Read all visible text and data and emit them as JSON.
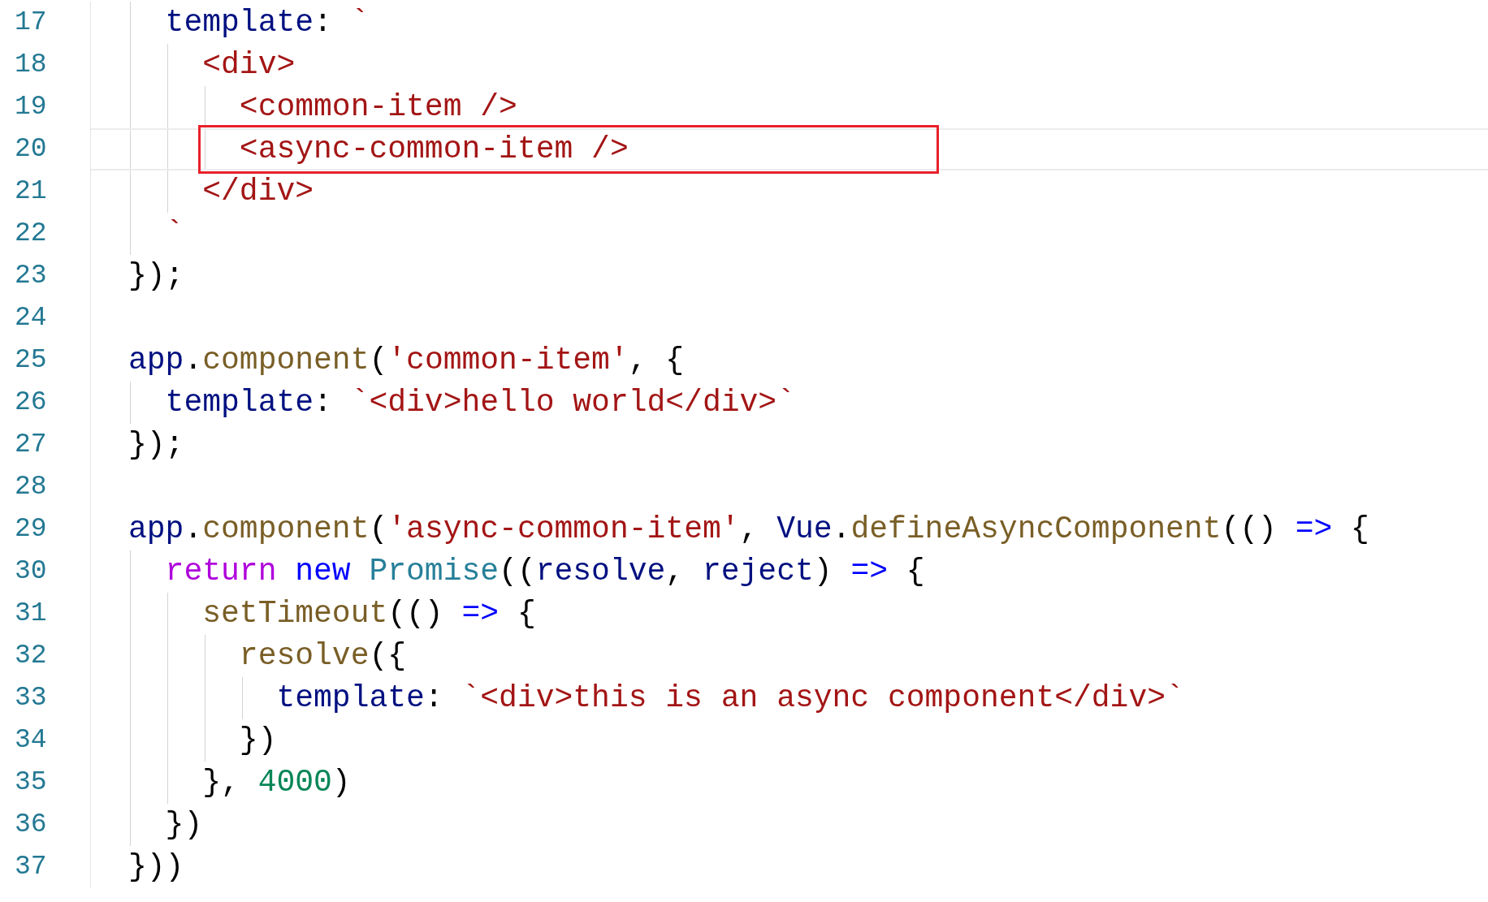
{
  "editor": {
    "lines": [
      {
        "number": "17",
        "current": false,
        "highlighted": false,
        "tokens": [
          {
            "text": "  template",
            "kind": "ident"
          },
          {
            "text": ": ",
            "kind": "plain"
          },
          {
            "text": "`",
            "kind": "string"
          }
        ]
      },
      {
        "number": "18",
        "current": false,
        "highlighted": false,
        "tokens": [
          {
            "text": "    <div>",
            "kind": "string"
          }
        ]
      },
      {
        "number": "19",
        "current": false,
        "highlighted": false,
        "tokens": [
          {
            "text": "      <common-item />",
            "kind": "string"
          }
        ]
      },
      {
        "number": "20",
        "current": true,
        "highlighted": true,
        "tokens": [
          {
            "text": "      <async-common-item />",
            "kind": "string"
          }
        ]
      },
      {
        "number": "21",
        "current": false,
        "highlighted": false,
        "tokens": [
          {
            "text": "    </div>",
            "kind": "string"
          }
        ]
      },
      {
        "number": "22",
        "current": false,
        "highlighted": false,
        "tokens": [
          {
            "text": "  `",
            "kind": "string"
          }
        ]
      },
      {
        "number": "23",
        "current": false,
        "highlighted": false,
        "tokens": [
          {
            "text": "});",
            "kind": "plain"
          }
        ]
      },
      {
        "number": "24",
        "current": false,
        "highlighted": false
      },
      {
        "number": "25",
        "current": false,
        "highlighted": false,
        "tokens": [
          {
            "text": "app",
            "kind": "ident"
          },
          {
            "text": ".",
            "kind": "plain"
          },
          {
            "text": "component",
            "kind": "func"
          },
          {
            "text": "(",
            "kind": "plain"
          },
          {
            "text": "'common-item'",
            "kind": "string"
          },
          {
            "text": ", {",
            "kind": "plain"
          }
        ]
      },
      {
        "number": "26",
        "current": false,
        "highlighted": false,
        "tokens": [
          {
            "text": "  template",
            "kind": "ident"
          },
          {
            "text": ": ",
            "kind": "plain"
          },
          {
            "text": "`<div>hello world</div>`",
            "kind": "string"
          }
        ]
      },
      {
        "number": "27",
        "current": false,
        "highlighted": false,
        "tokens": [
          {
            "text": "});",
            "kind": "plain"
          }
        ]
      },
      {
        "number": "28",
        "current": false,
        "highlighted": false
      },
      {
        "number": "29",
        "current": false,
        "highlighted": false,
        "tokens": [
          {
            "text": "app",
            "kind": "ident"
          },
          {
            "text": ".",
            "kind": "plain"
          },
          {
            "text": "component",
            "kind": "func"
          },
          {
            "text": "(",
            "kind": "plain"
          },
          {
            "text": "'async-common-item'",
            "kind": "string"
          },
          {
            "text": ", ",
            "kind": "plain"
          },
          {
            "text": "Vue",
            "kind": "ident"
          },
          {
            "text": ".",
            "kind": "plain"
          },
          {
            "text": "defineAsyncComponent",
            "kind": "func"
          },
          {
            "text": "(() ",
            "kind": "plain"
          },
          {
            "text": "=>",
            "kind": "keyword"
          },
          {
            "text": " {",
            "kind": "plain"
          }
        ]
      },
      {
        "number": "30",
        "current": false,
        "highlighted": false,
        "tokens": [
          {
            "text": "  return",
            "kind": "control"
          },
          {
            "text": " new",
            "kind": "keyword"
          },
          {
            "text": " Promise",
            "kind": "type"
          },
          {
            "text": "((",
            "kind": "plain"
          },
          {
            "text": "resolve",
            "kind": "ident"
          },
          {
            "text": ", ",
            "kind": "plain"
          },
          {
            "text": "reject",
            "kind": "ident"
          },
          {
            "text": ") ",
            "kind": "plain"
          },
          {
            "text": "=>",
            "kind": "keyword"
          },
          {
            "text": " {",
            "kind": "plain"
          }
        ]
      },
      {
        "number": "31",
        "current": false,
        "highlighted": false,
        "tokens": [
          {
            "text": "    setTimeout",
            "kind": "func"
          },
          {
            "text": "(() ",
            "kind": "plain"
          },
          {
            "text": "=>",
            "kind": "keyword"
          },
          {
            "text": " {",
            "kind": "plain"
          }
        ]
      },
      {
        "number": "32",
        "current": false,
        "highlighted": false,
        "tokens": [
          {
            "text": "      resolve",
            "kind": "func"
          },
          {
            "text": "({",
            "kind": "plain"
          }
        ]
      },
      {
        "number": "33",
        "current": false,
        "highlighted": false,
        "tokens": [
          {
            "text": "        template",
            "kind": "ident"
          },
          {
            "text": ": ",
            "kind": "plain"
          },
          {
            "text": "`<div>this is an async component</div>`",
            "kind": "string"
          }
        ]
      },
      {
        "number": "34",
        "current": false,
        "highlighted": false,
        "tokens": [
          {
            "text": "      })",
            "kind": "plain"
          }
        ]
      },
      {
        "number": "35",
        "current": false,
        "highlighted": false,
        "tokens": [
          {
            "text": "    }, ",
            "kind": "plain"
          },
          {
            "text": "4000",
            "kind": "number"
          },
          {
            "text": ")",
            "kind": "plain"
          }
        ]
      },
      {
        "number": "36",
        "current": false,
        "highlighted": false,
        "tokens": [
          {
            "text": "  })",
            "kind": "plain"
          }
        ]
      },
      {
        "number": "37",
        "current": false,
        "highlighted": false,
        "tokens": [
          {
            "text": "}))",
            "kind": "plain"
          }
        ]
      }
    ]
  }
}
